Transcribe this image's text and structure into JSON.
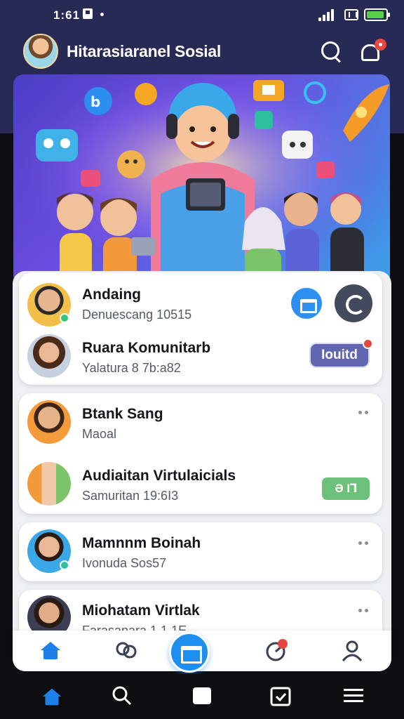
{
  "status_bar": {
    "time": "1:61"
  },
  "header": {
    "title": "Hitarasiaranel Sosial"
  },
  "list": [
    {
      "name": "Andaing",
      "subtitle": "Denuescang 10515"
    },
    {
      "name": "Ruara Komunitarb",
      "subtitle": "Yalatura 8 7b:a82",
      "action_label": "Iouitd"
    },
    {
      "name": "Btank Sang",
      "subtitle": "Maoal"
    },
    {
      "name": "Audiaitan Virtulaicials",
      "subtitle": "Samuritan 19:6I3",
      "tag_label": "Ә I⅂"
    },
    {
      "name": "Mamnnm Boinah",
      "subtitle": "Ivonuda Sos57"
    },
    {
      "name": "Miohatam Virtlak",
      "subtitle": "Farasanara 1 1 1E"
    }
  ],
  "colors": {
    "header_bg": "#262a55",
    "accent": "#1e8ef0",
    "badge": "#e5473f",
    "online": "#38c47a"
  },
  "icons": [
    "search-icon",
    "bell-icon",
    "home-icon",
    "people-icon",
    "chat-icon",
    "gauge-icon",
    "profile-icon",
    "back-icon"
  ]
}
